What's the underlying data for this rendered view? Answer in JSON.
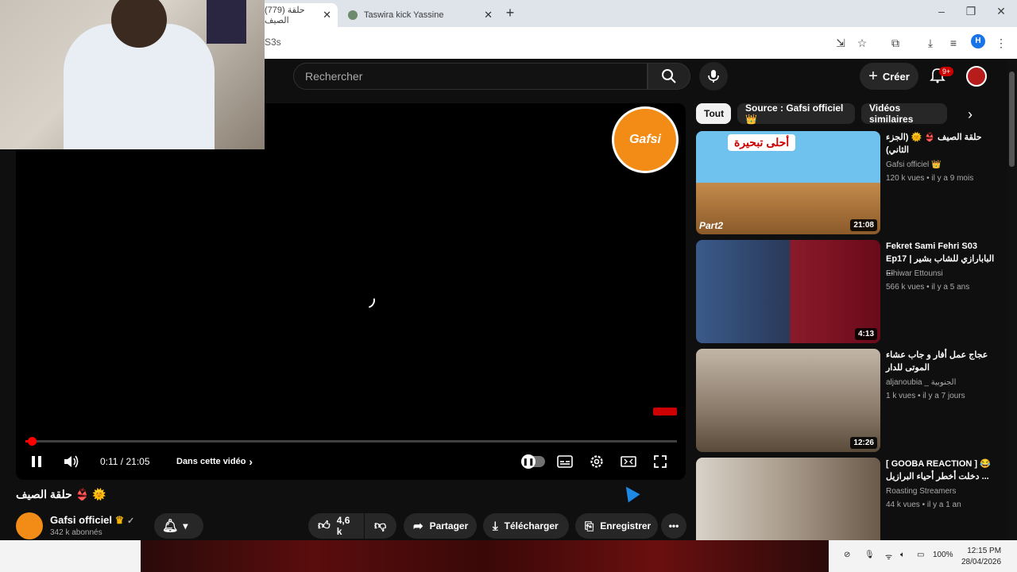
{
  "browser": {
    "tabs": [
      {
        "label": "(779) حلقة الصيف",
        "active": true
      },
      {
        "label": "Taswira kick Yassine",
        "active": false
      }
    ],
    "new_tab": "+",
    "url_fragment": "S3s",
    "profile_initial": "H",
    "window_controls": [
      "–",
      "❐",
      "✕"
    ]
  },
  "youtube_header": {
    "search_placeholder": "Rechercher",
    "create_label": "Créer",
    "notif_badge": "9+"
  },
  "player": {
    "current_time": "0:11",
    "duration": "21:05",
    "time_display": "0:11 / 21:05",
    "progress_fraction": 0.009,
    "in_video_label": "Dans cette vidéo",
    "overlay_logo_text": "Gafsi"
  },
  "video": {
    "title": "حلقة الصيف 👙 🌞",
    "channel_name": "Gafsi officiel",
    "subscribers": "342 k abonnés",
    "likes": "4,6 k",
    "share_label": "Partager",
    "download_label": "Télécharger",
    "save_label": "Enregistrer"
  },
  "chips": [
    "Tout",
    "Source : Gafsi officiel 👑",
    "Vidéos similaires"
  ],
  "recommendations": [
    {
      "title": "حلقة الصيف 👙 🌞 (الجزء الثاني)",
      "channel": "Gafsi officiel 👑",
      "meta": "120 k vues • il y a 9 mois",
      "duration": "21:08",
      "thumb_text": "أحلى تبحيرة",
      "color": "#5aa9d6"
    },
    {
      "title": "Fekret Sami Fehri S03 Ep17 | البابارازي للشاب بشير ...",
      "channel": "Elhiwar Ettounsi",
      "meta": "566 k vues • il y a 5 ans",
      "duration": "4:13",
      "thumb_text": "",
      "color": "#8a2a3a"
    },
    {
      "title": "عجاج عمل أفار و جاب عشاء الموتى للدار",
      "channel": "aljanoubia _ الجنوبية",
      "meta": "1 k vues • il y a 7 jours",
      "duration": "12:26",
      "thumb_text": "",
      "color": "#7c6f63"
    },
    {
      "title": "[ GOOBA REACTION ] 😂 دخلت أخطر أحياء البرازيل ...",
      "channel": "Roasting Streamers",
      "meta": "44 k vues • il y a 1 an",
      "duration": "",
      "thumb_text": "",
      "color": "#9a8a7a"
    }
  ],
  "taskbar": {
    "battery": "100%",
    "time": "12:15 PM",
    "date": "28/04/2026"
  }
}
